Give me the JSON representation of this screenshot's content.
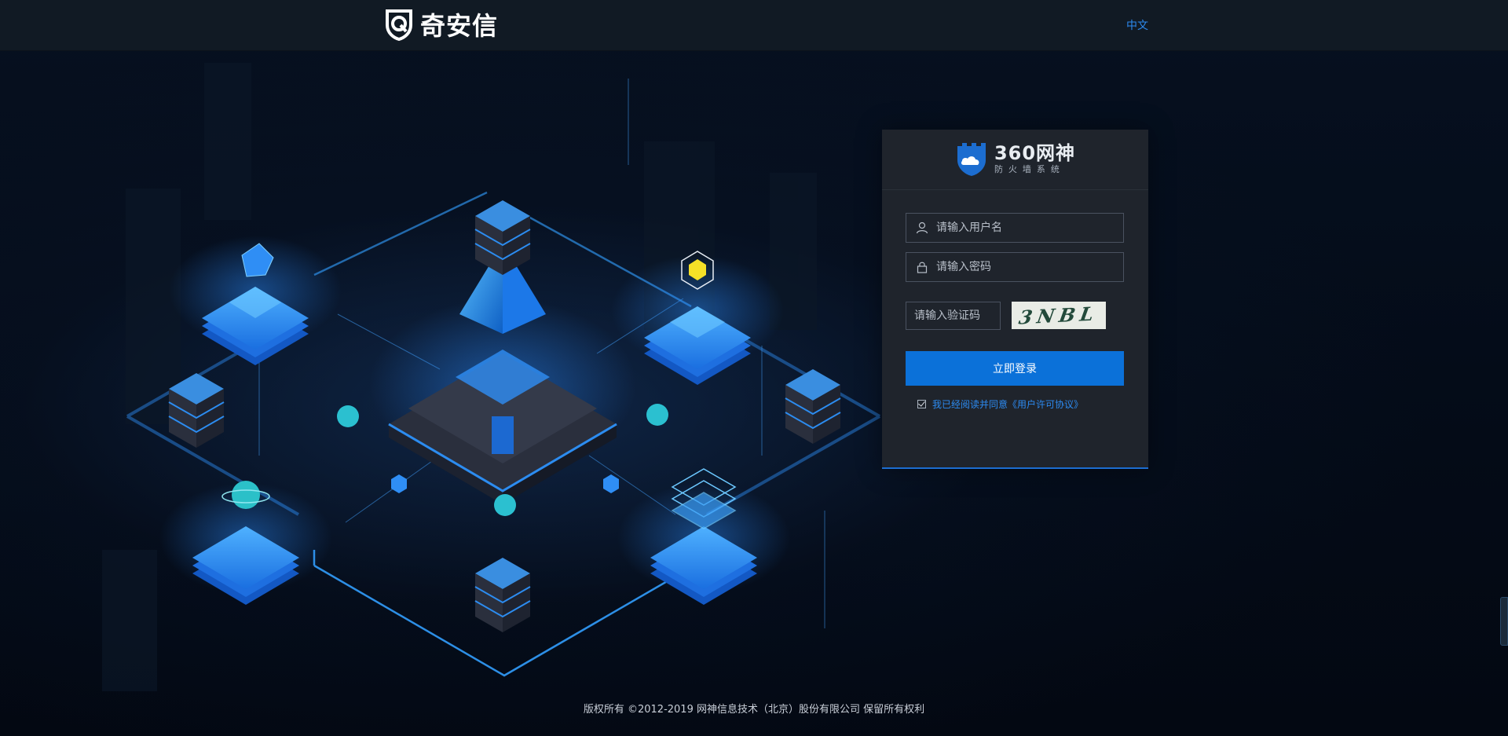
{
  "header": {
    "brand_text": "奇安信",
    "language": "中文"
  },
  "login": {
    "product_title": "360网神",
    "product_subtitle": "防火墙系统",
    "username_placeholder": "请输入用户名",
    "password_placeholder": "请输入密码",
    "captcha_placeholder": "请输入验证码",
    "captcha_text": "3NBL",
    "login_button": "立即登录",
    "agreement_text": "我已经阅读并同意《用户许可协议》",
    "agreement_checked": true
  },
  "footer": {
    "copyright": "版权所有 ©2012-2019 网神信息技术（北京）股份有限公司 保留所有权利"
  },
  "colors": {
    "accent": "#0b71d9",
    "link": "#2c8af0",
    "topbar": "#111a24",
    "panel": "#1f242c",
    "background": "#050d1a"
  }
}
